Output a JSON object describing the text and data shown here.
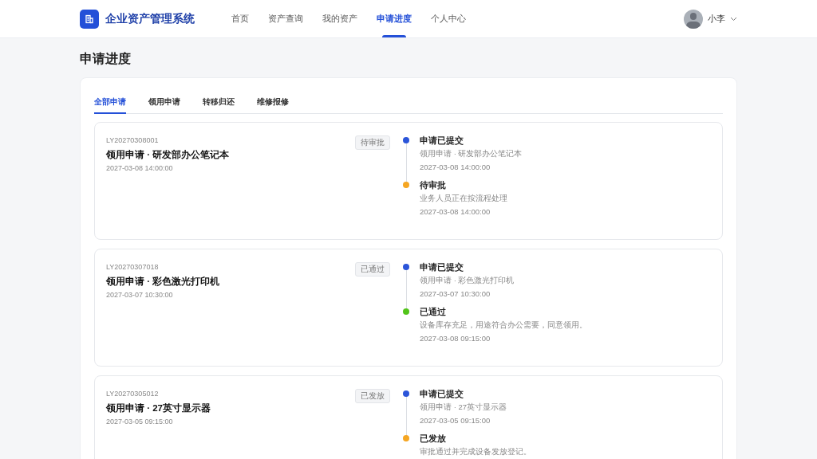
{
  "header": {
    "app_title": "企业资产管理系统",
    "nav": [
      {
        "label": "首页",
        "selected": false
      },
      {
        "label": "资产查询",
        "selected": false
      },
      {
        "label": "我的资产",
        "selected": false
      },
      {
        "label": "申请进度",
        "selected": true
      },
      {
        "label": "个人中心",
        "selected": false
      }
    ],
    "user": {
      "name": "小李"
    }
  },
  "page_title": "申请进度",
  "tabs": [
    {
      "label": "全部申请",
      "selected": true
    },
    {
      "label": "领用申请",
      "selected": false
    },
    {
      "label": "转移归还",
      "selected": false
    },
    {
      "label": "维修报修",
      "selected": false
    }
  ],
  "applications": [
    {
      "id": "LY20270308001",
      "title": "领用申请 · 研发部办公笔记本",
      "time": "2027-03-08 14:00:00",
      "status": "待审批",
      "events": [
        {
          "title": "申请已提交",
          "detail": "领用申请 · 研发部办公笔记本",
          "time": "2027-03-08 14:00:00",
          "color": "#2b55d9"
        },
        {
          "title": "待审批",
          "detail": "业务人员正在按流程处理",
          "time": "2027-03-08 14:00:00",
          "color": "#f5a623"
        }
      ]
    },
    {
      "id": "LY20270307018",
      "title": "领用申请 · 彩色激光打印机",
      "time": "2027-03-07 10:30:00",
      "status": "已通过",
      "events": [
        {
          "title": "申请已提交",
          "detail": "领用申请 · 彩色激光打印机",
          "time": "2027-03-07 10:30:00",
          "color": "#2b55d9"
        },
        {
          "title": "已通过",
          "detail": "设备库存充足，用途符合办公需要，同意领用。",
          "time": "2027-03-08 09:15:00",
          "color": "#52c41a"
        }
      ]
    },
    {
      "id": "LY20270305012",
      "title": "领用申请 · 27英寸显示器",
      "time": "2027-03-05 09:15:00",
      "status": "已发放",
      "events": [
        {
          "title": "申请已提交",
          "detail": "领用申请 · 27英寸显示器",
          "time": "2027-03-05 09:15:00",
          "color": "#2b55d9"
        },
        {
          "title": "已发放",
          "detail": "审批通过并完成设备发放登记。",
          "color": "#f5a623"
        }
      ]
    }
  ]
}
